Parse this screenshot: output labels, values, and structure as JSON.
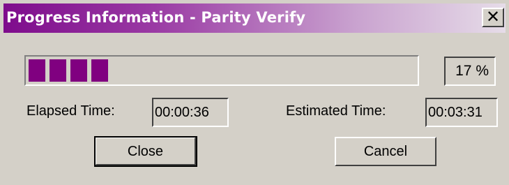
{
  "window": {
    "title": "Progress Information - Parity Verify",
    "close_glyph": "✕"
  },
  "progress": {
    "percent": 17,
    "percent_label": "17 %",
    "fill_color": "#800080",
    "filled_blocks": 4
  },
  "elapsed": {
    "label": "Elapsed Time:",
    "value": "00:00:36"
  },
  "estimated": {
    "label": "Estimated Time:",
    "value": "00:03:31"
  },
  "buttons": {
    "close": "Close",
    "cancel": "Cancel"
  },
  "colors": {
    "title_start": "#7e0c8c",
    "title_end": "#e6dce8",
    "face": "#d4d0c8"
  }
}
